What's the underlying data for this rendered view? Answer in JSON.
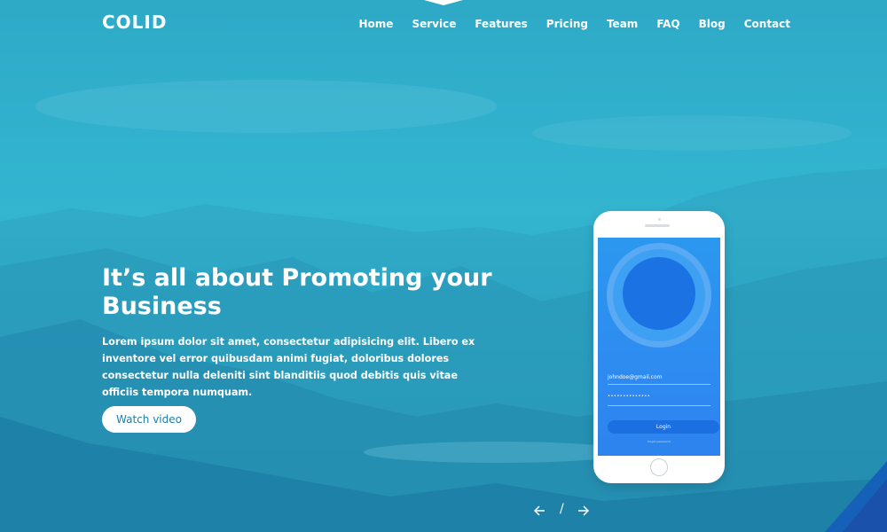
{
  "brand": {
    "logo": "COLID"
  },
  "nav": {
    "items": [
      "Home",
      "Service",
      "Features",
      "Pricing",
      "Team",
      "FAQ",
      "Blog",
      "Contact"
    ],
    "active": "Home"
  },
  "hero": {
    "headline": "It’s all about Promoting your Business",
    "paragraph": "Lorem ipsum dolor sit amet, consectetur adipisicing elit. Libero ex inventore vel error quibusdam animi fugiat, doloribus dolores consectetur nulla deleniti sint blanditiis quod debitis quis vitae officiis tempora numquam.",
    "cta": "Watch video"
  },
  "phone": {
    "email_value": "johndoe@gmail.com",
    "password_value": "••••••••••••••",
    "login_label": "Login",
    "forgot_label": "Forgot password?"
  },
  "slider": {
    "separator": "/"
  },
  "icons": {
    "prev": "arrow-left-icon",
    "next": "arrow-right-icon"
  },
  "colors": {
    "hero_overlay": "#2aa7c4",
    "accent_dark": "#1d7fa5",
    "phone_screen": "#2e8bf0",
    "login_button": "#1c6fe0"
  }
}
